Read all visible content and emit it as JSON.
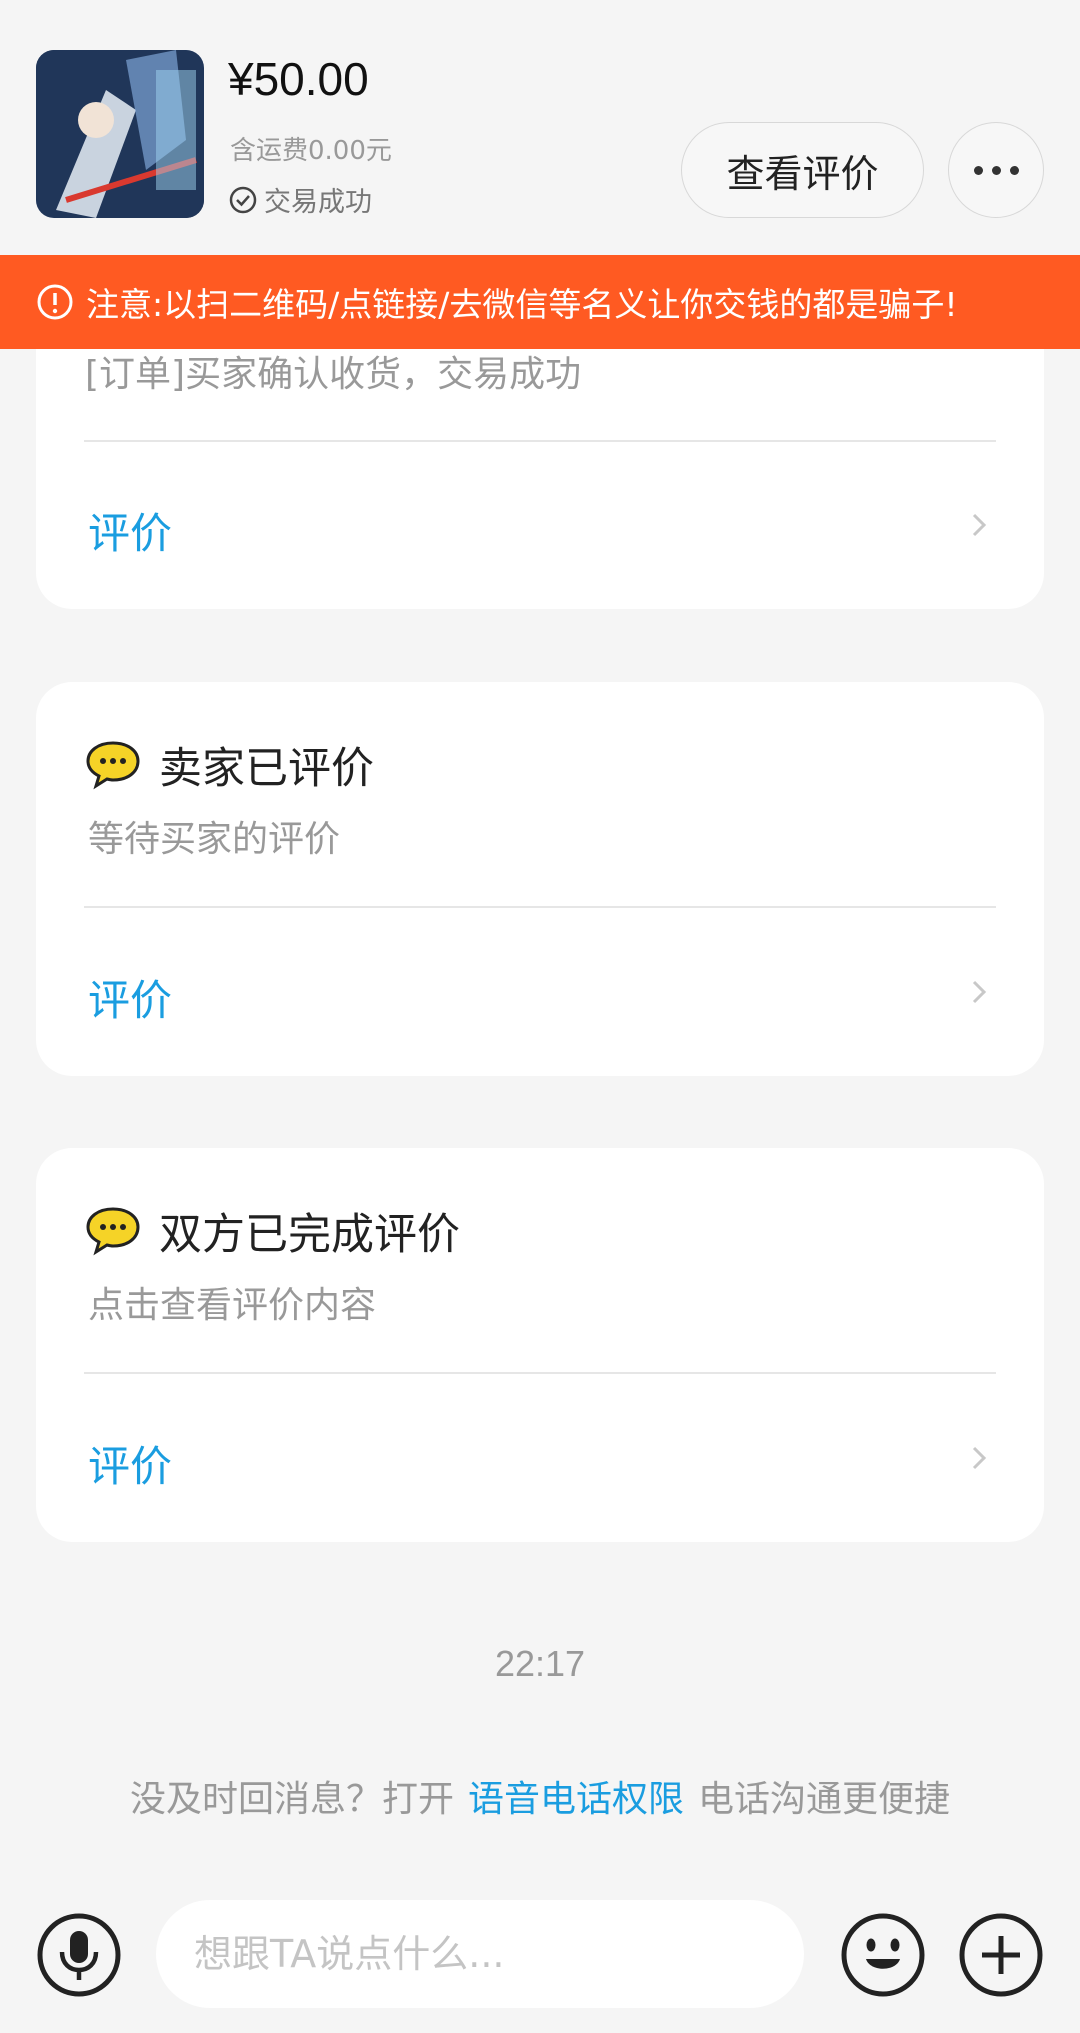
{
  "header": {
    "price": "¥50.00",
    "shipping": "含运费0.00元",
    "status": "交易成功",
    "review_button": "查看评价"
  },
  "warning": {
    "text": "注意:以扫二维码/点链接/去微信等名义让你交钱的都是骗子!"
  },
  "cards": [
    {
      "subtitle": "[订单]买家确认收货，交易成功",
      "action": "评价"
    },
    {
      "title": "卖家已评价",
      "subtitle": "等待买家的评价",
      "action": "评价"
    },
    {
      "title": "双方已完成评价",
      "subtitle": "点击查看评价内容",
      "action": "评价"
    }
  ],
  "time": "22:17",
  "tip": {
    "before": "没及时回消息？打开",
    "link": "语音电话权限",
    "after": "电话沟通更便捷"
  },
  "input": {
    "placeholder": "想跟TA说点什么..."
  },
  "colors": {
    "accent": "#1a9de0",
    "warning": "#ff5a22",
    "background": "#f5f5f5",
    "chat_icon": "#f5d327"
  },
  "icons": {
    "status": "check-circle-icon",
    "warning": "alert-circle-icon",
    "card_title": "chat-bubble-icon",
    "more": "more-dots-icon",
    "chevron": "chevron-right-icon",
    "mic": "microphone-icon",
    "emoji": "smiley-icon",
    "plus": "plus-circle-icon"
  }
}
